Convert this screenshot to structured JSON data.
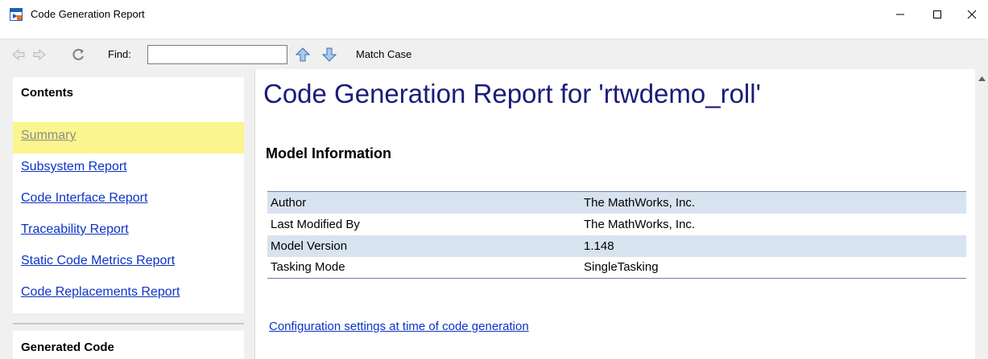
{
  "window": {
    "title": "Code Generation Report",
    "minimize_glyph": "—",
    "close_glyph": "✕"
  },
  "toolbar": {
    "find_label": "Find:",
    "find_value": "",
    "match_case_label": "Match Case",
    "icons": [
      "back-arrow-icon",
      "forward-arrow-icon",
      "refresh-icon",
      "find-up-icon",
      "find-down-icon"
    ]
  },
  "sidebar": {
    "contents_title": "Contents",
    "items": [
      {
        "label": "Summary",
        "active": true
      },
      {
        "label": "Subsystem Report"
      },
      {
        "label": "Code Interface Report"
      },
      {
        "label": "Traceability Report"
      },
      {
        "label": "Static Code Metrics Report"
      },
      {
        "label": "Code Replacements Report"
      }
    ],
    "generated_code_title": "Generated Code"
  },
  "main": {
    "title": "Code Generation Report for 'rtwdemo_roll'",
    "section_title": "Model Information",
    "rows": [
      {
        "key": "Author",
        "value": "The MathWorks, Inc."
      },
      {
        "key": "Last Modified By",
        "value": "The MathWorks, Inc."
      },
      {
        "key": "Model Version",
        "value": "1.148"
      },
      {
        "key": "Tasking Mode",
        "value": "SingleTasking"
      }
    ],
    "config_link": "Configuration settings at time of code generation"
  },
  "colors": {
    "link": "#0b33c7",
    "title": "#1b1b7a",
    "highlight": "#faf58c",
    "row_alt": "#d8e3f0"
  }
}
